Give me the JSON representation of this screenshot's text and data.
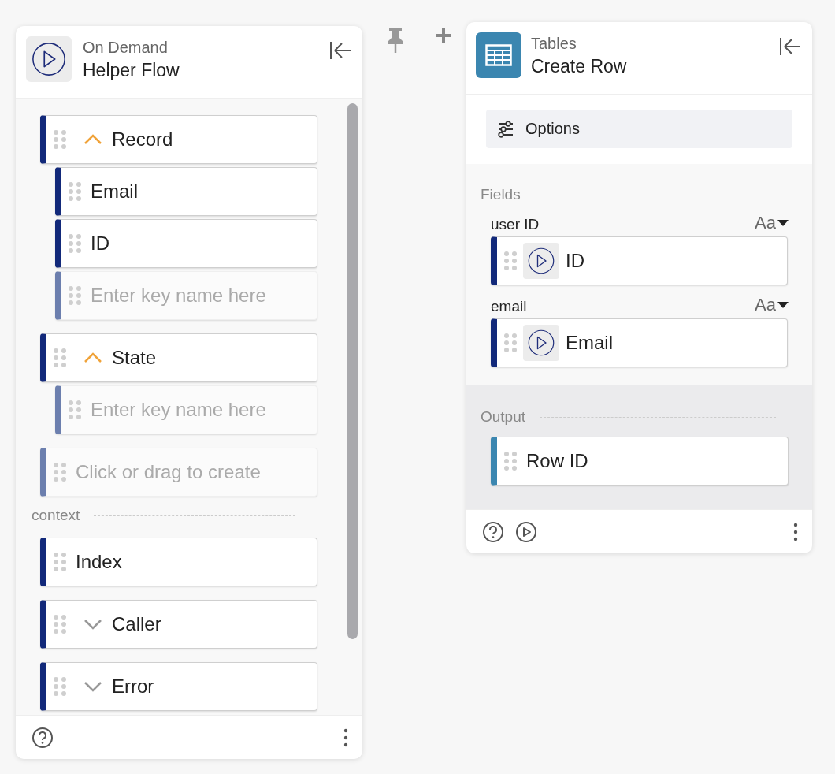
{
  "flow_panel": {
    "subtitle": "On Demand",
    "title": "Helper Flow",
    "items": [
      {
        "kind": "key",
        "label": "Record",
        "expanded": true,
        "children": [
          {
            "kind": "key",
            "label": "Email"
          },
          {
            "kind": "key",
            "label": "ID"
          },
          {
            "kind": "empty",
            "placeholder": "Enter key name here"
          }
        ]
      },
      {
        "kind": "key",
        "label": "State",
        "expanded": true,
        "children": [
          {
            "kind": "empty",
            "placeholder": "Enter key name here"
          }
        ]
      },
      {
        "kind": "empty",
        "placeholder": "Click or drag to create"
      }
    ],
    "context": {
      "label": "context",
      "items": [
        {
          "kind": "key",
          "label": "Index"
        },
        {
          "kind": "key",
          "label": "Caller",
          "expanded": false
        },
        {
          "kind": "key",
          "label": "Error",
          "expanded": false
        }
      ]
    }
  },
  "action_panel": {
    "subtitle": "Tables",
    "title": "Create Row",
    "options_button": "Options",
    "fields": {
      "label": "Fields",
      "items": [
        {
          "label": "user ID",
          "type": "Aa",
          "value": "ID"
        },
        {
          "label": "email",
          "type": "Aa",
          "value": "Email"
        }
      ]
    },
    "output": {
      "label": "Output",
      "items": [
        {
          "label": "Row ID"
        }
      ]
    }
  }
}
